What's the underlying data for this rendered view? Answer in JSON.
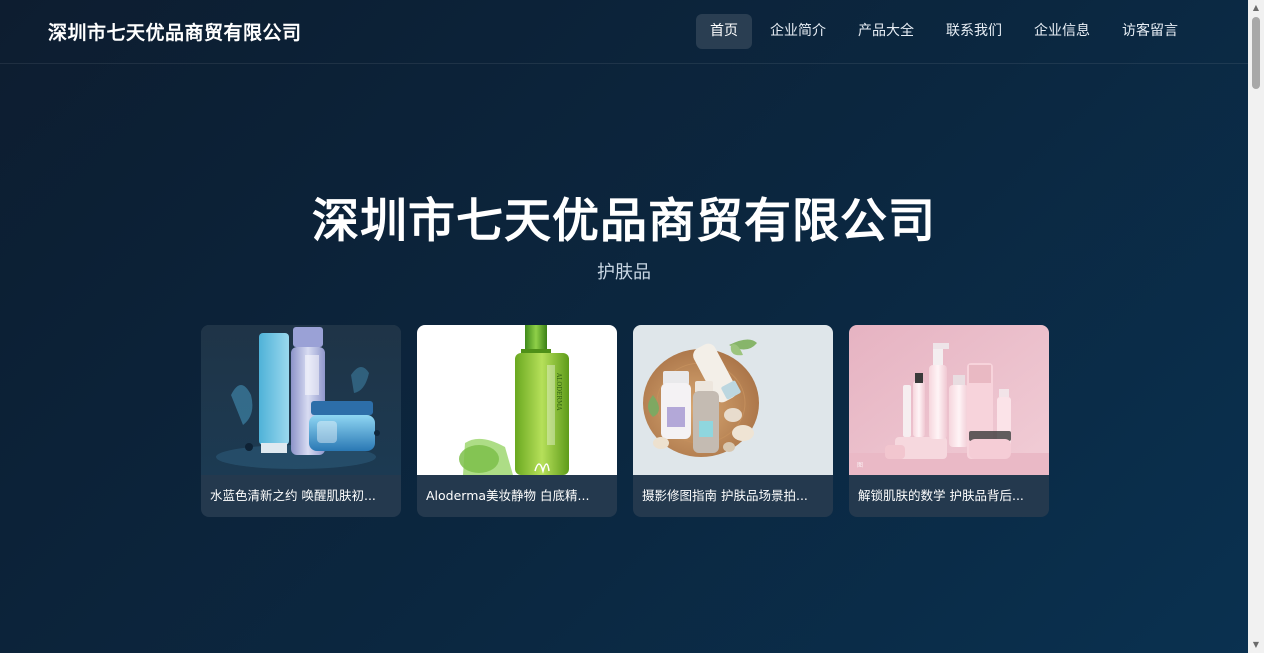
{
  "header": {
    "brand": "深圳市七天优品商贸有限公司",
    "nav": [
      {
        "label": "首页",
        "active": true
      },
      {
        "label": "企业简介"
      },
      {
        "label": "产品大全"
      },
      {
        "label": "联系我们"
      },
      {
        "label": "企业信息"
      },
      {
        "label": "访客留言"
      }
    ]
  },
  "hero": {
    "title": "深圳市七天优品商贸有限公司",
    "subtitle": "护肤品"
  },
  "cards": [
    {
      "caption": "水蓝色清新之约 唤醒肌肤初...",
      "image": "blue-skincare-products"
    },
    {
      "caption": "Aloderma美妆静物 白底精...",
      "image": "green-aloe-bottle"
    },
    {
      "caption": "摄影修图指南 护肤品场景拍...",
      "image": "skincare-on-wood-tray"
    },
    {
      "caption": "解锁肌肤的数学 护肤品背后...",
      "image": "pink-skincare-set"
    }
  ],
  "colors": {
    "bg_start": "#0d1d30",
    "bg_end": "#0a3150",
    "nav_active": "#2a3e52",
    "card_caption_bg": "#24394e"
  }
}
